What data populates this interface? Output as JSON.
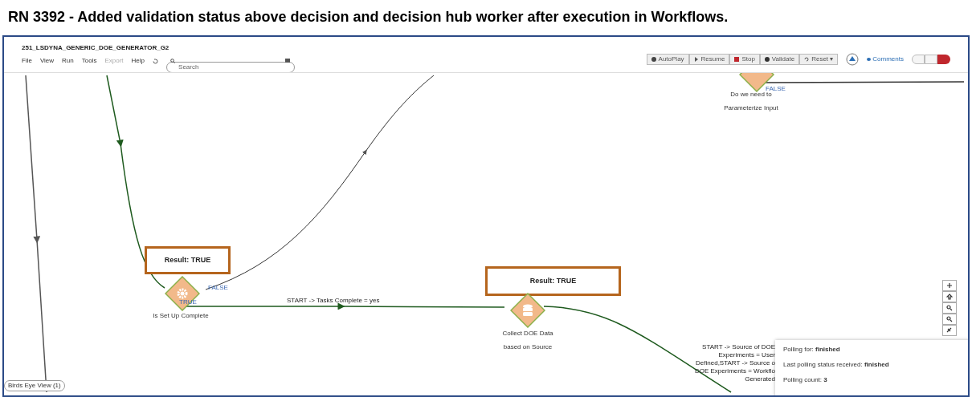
{
  "slide_title": "RN 3392 - Added validation status above decision and decision hub worker  after execution in Workflows.",
  "app": {
    "title": "251_LSDYNA_GENERIC_DOE_GENERATOR_G2",
    "menu": [
      {
        "label": "File",
        "disabled": false
      },
      {
        "label": "View",
        "disabled": false
      },
      {
        "label": "Run",
        "disabled": false
      },
      {
        "label": "Tools",
        "disabled": false
      },
      {
        "label": "Export",
        "disabled": true
      },
      {
        "label": "Help",
        "disabled": false
      }
    ],
    "search": {
      "placeholder": "Search"
    },
    "toolbar": [
      {
        "label": "AutoPlay",
        "kind": "play"
      },
      {
        "label": "Resume",
        "kind": "resume"
      },
      {
        "label": "Stop",
        "kind": "stop"
      },
      {
        "label": "Validate",
        "kind": "validate"
      },
      {
        "label": "Reset ▾",
        "kind": "reset"
      }
    ],
    "comments": "Comments"
  },
  "canvas": {
    "nodes": [
      {
        "kind": "gear",
        "result": "Result: TRUE",
        "label": [
          "Is Set Up Complete"
        ],
        "branches": [
          {
            "label": "FALSE"
          },
          {
            "label": "TRUE"
          }
        ]
      },
      {
        "kind": "database",
        "result": "Result: TRUE",
        "label": [
          "Collect DOE Data",
          "based on Source"
        ]
      },
      {
        "kind": "partial",
        "label": [
          "Do we need to",
          "Parameterize Input"
        ],
        "branches": [
          {
            "label": "FALSE"
          }
        ]
      }
    ],
    "edge_labels": [
      [
        "START -> Tasks Complete = yes"
      ],
      [
        "START -> Source of DOE",
        "Experiments = User",
        "Defined,START -> Source o",
        "DOE Experiments = Workflo",
        "Generated"
      ]
    ],
    "birds_eye": "Birds Eye View (1)"
  },
  "popup": {
    "lines": [
      "Polling for: **finished**",
      "Last polling status received: **finished**",
      "Polling count: **3**"
    ]
  }
}
